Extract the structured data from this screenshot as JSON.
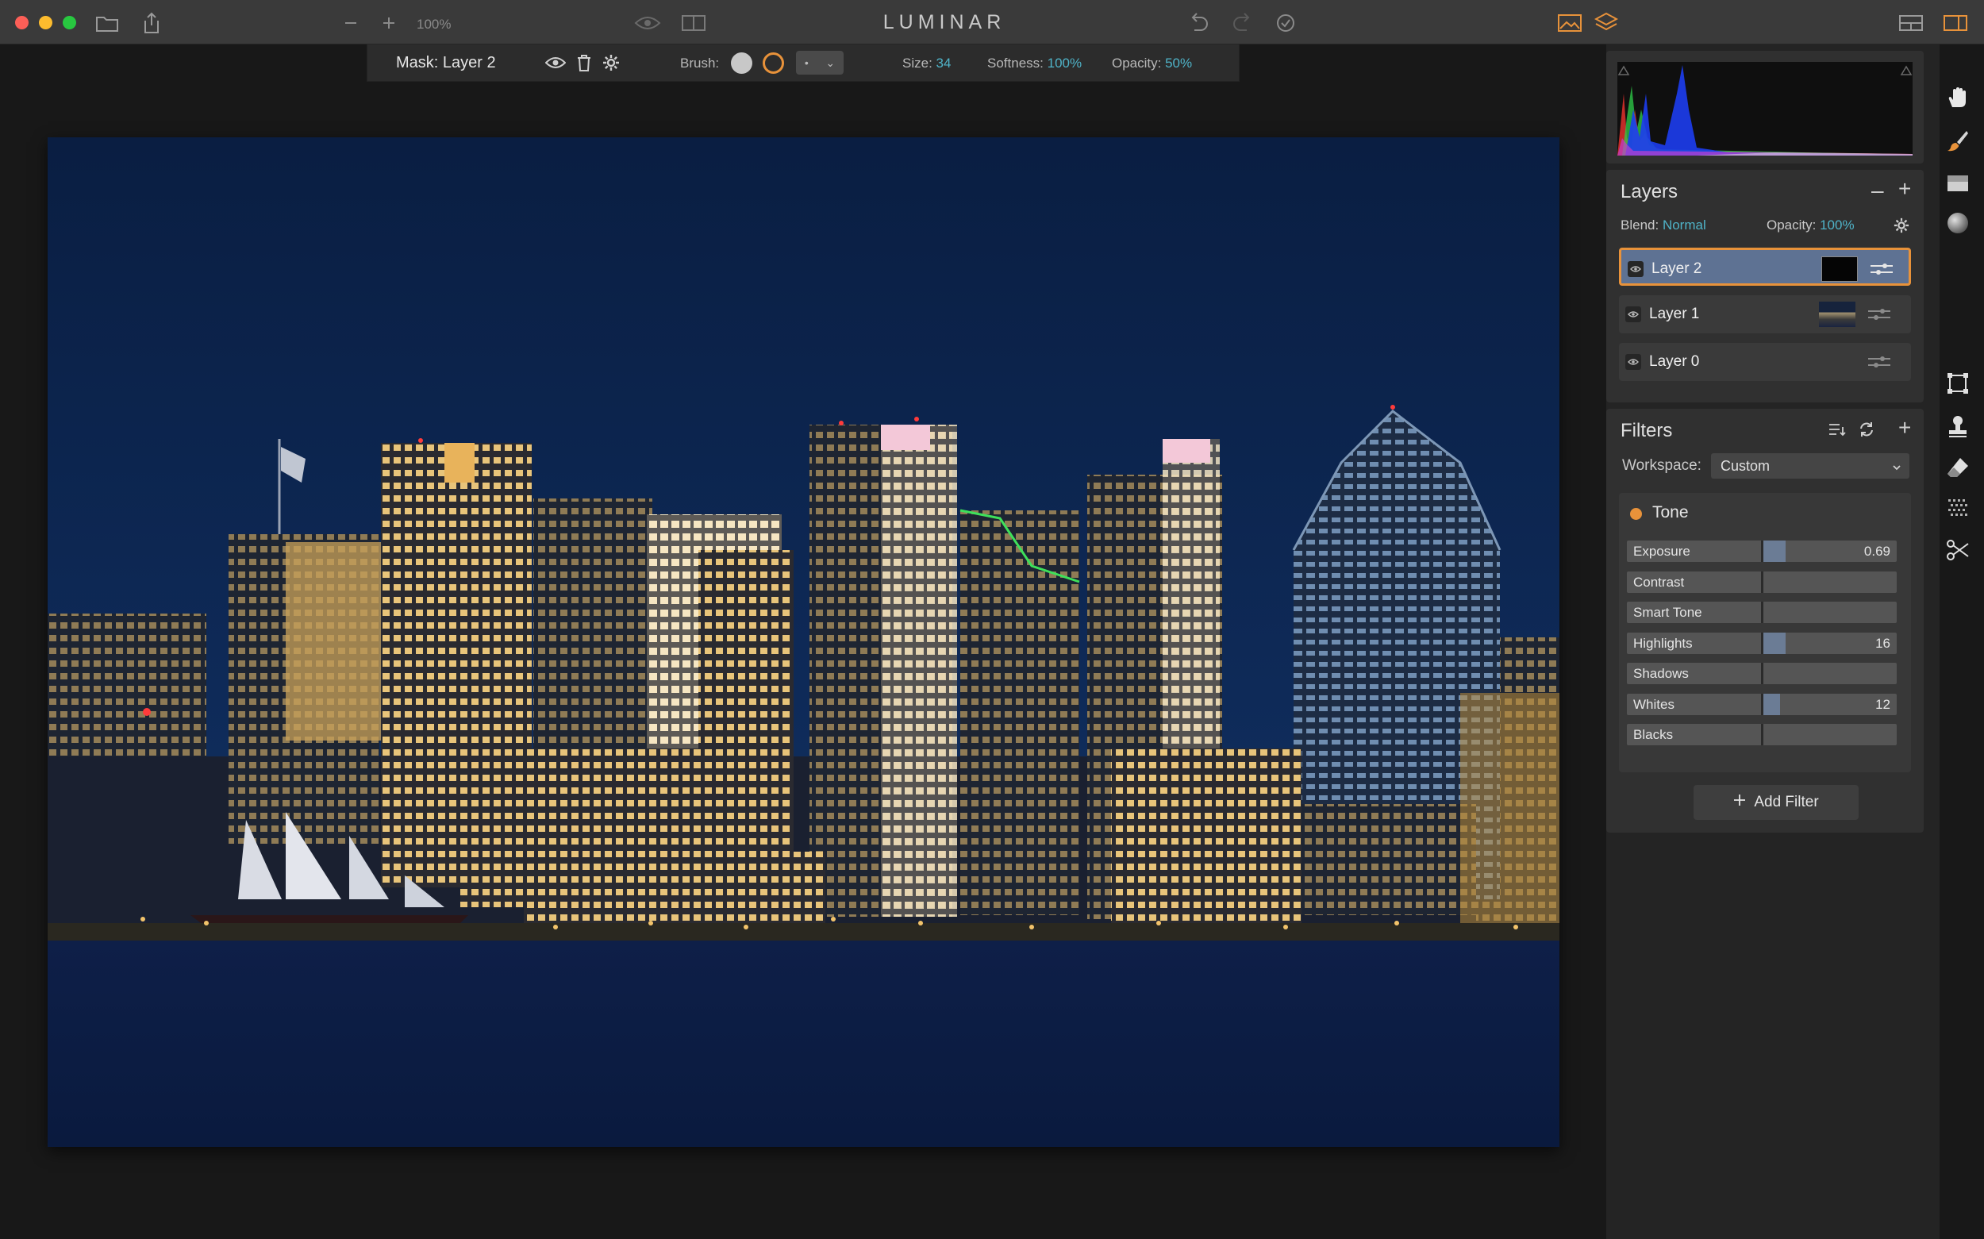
{
  "app": {
    "title": "LUMINAR",
    "zoom": "100%"
  },
  "mask_toolbar": {
    "title": "Mask: Layer 2",
    "brush_label": "Brush:",
    "size_label": "Size:",
    "size_value": "34",
    "softness_label": "Softness:",
    "softness_value": "100%",
    "opacity_label": "Opacity:",
    "opacity_value": "50%"
  },
  "layers": {
    "title": "Layers",
    "blend_label": "Blend:",
    "blend_value": "Normal",
    "opacity_label": "Opacity:",
    "opacity_value": "100%",
    "items": [
      {
        "name": "Layer 2",
        "active": true
      },
      {
        "name": "Layer 1",
        "active": false
      },
      {
        "name": "Layer 0",
        "active": false
      }
    ]
  },
  "filters": {
    "title": "Filters",
    "workspace_label": "Workspace:",
    "workspace_value": "Custom",
    "tone": {
      "title": "Tone",
      "sliders": [
        {
          "label": "Exposure",
          "value": "0.69",
          "level": 0.09
        },
        {
          "label": "Contrast",
          "value": "",
          "level": 0
        },
        {
          "label": "Smart Tone",
          "value": "",
          "level": 0
        },
        {
          "label": "Highlights",
          "value": "16",
          "level": 0.09
        },
        {
          "label": "Shadows",
          "value": "",
          "level": 0
        },
        {
          "label": "Whites",
          "value": "12",
          "level": 0.07
        },
        {
          "label": "Blacks",
          "value": "",
          "level": 0
        }
      ]
    },
    "add_filter_label": "Add Filter"
  },
  "colors": {
    "accent": "#4fb3c8",
    "selection": "#e8923a",
    "active_layer": "#5e7293"
  }
}
